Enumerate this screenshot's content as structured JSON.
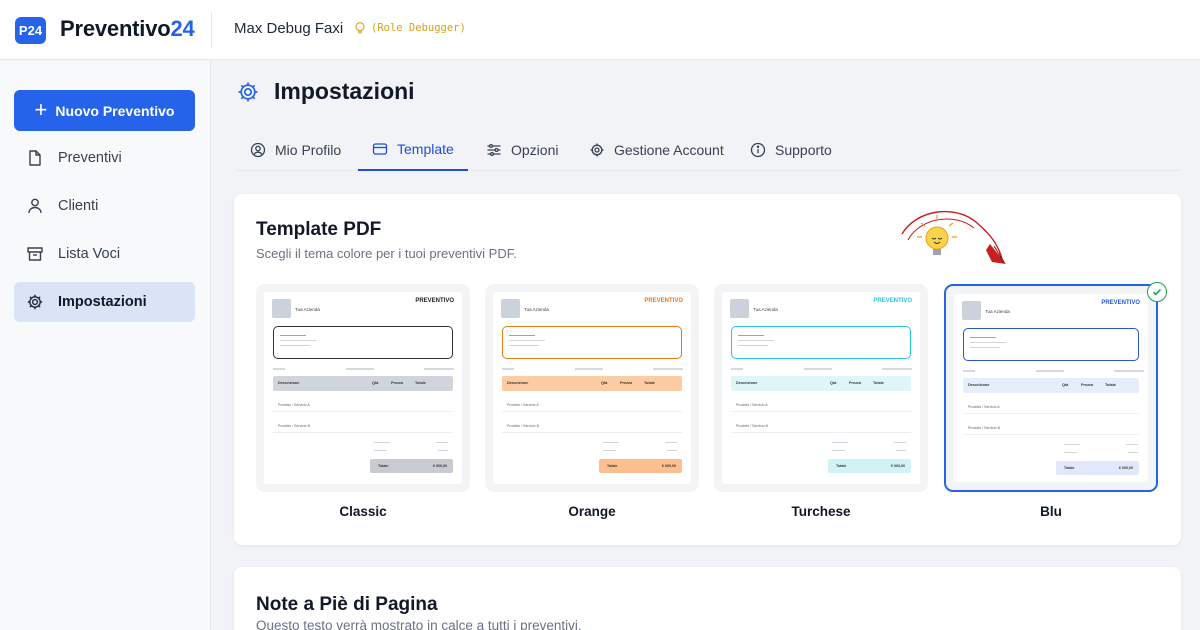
{
  "header": {
    "logo_badge": "P24",
    "app_name_main": "Preventivo",
    "app_name_accent": "24",
    "user_name": "Max Debug Faxi",
    "user_role": "(Role Debugger)"
  },
  "sidebar": {
    "new_button": "Nuovo Preventivo",
    "items": [
      {
        "label": "Preventivi",
        "icon": "document-icon"
      },
      {
        "label": "Clienti",
        "icon": "user-icon"
      },
      {
        "label": "Lista Voci",
        "icon": "archive-icon"
      },
      {
        "label": "Impostazioni",
        "icon": "gear-icon",
        "active": true
      }
    ]
  },
  "page": {
    "title": "Impostazioni",
    "tabs": [
      {
        "label": "Mio Profilo",
        "icon": "user-circle-icon"
      },
      {
        "label": "Template",
        "icon": "card-icon",
        "active": true
      },
      {
        "label": "Opzioni",
        "icon": "sliders-icon"
      },
      {
        "label": "Gestione Account",
        "icon": "gear-icon"
      },
      {
        "label": "Supporto",
        "icon": "info-icon"
      }
    ]
  },
  "template_card": {
    "title": "Template PDF",
    "subtitle": "Scegli il tema colore per i tuoi preventivi PDF.",
    "selected": "Blu",
    "templates": [
      {
        "name": "Classic",
        "accent": "#222222",
        "fill": "#d1d5db",
        "total_fill": "#c8cbd0"
      },
      {
        "name": "Orange",
        "accent": "#ea7a12",
        "fill": "#fdcba4",
        "total_fill": "#fdbf8f"
      },
      {
        "name": "Turchese",
        "accent": "#2ac7d6",
        "fill": "#dff6f8",
        "total_fill": "#d2f3f6"
      },
      {
        "name": "Blu",
        "accent": "#2a56d6",
        "fill": "#e8edfc",
        "total_fill": "#e2e8fb"
      }
    ],
    "preview": {
      "company": "Tua Azienda",
      "heading": "PREVENTIVO",
      "col_desc": "Descrizione",
      "col_qty": "Qtà",
      "col_price": "Prezzo",
      "col_total": "Totale",
      "row1": "Prodotto / Servizio A",
      "row2": "Prodotto / Servizio B",
      "total_label": "Totale",
      "total_value": "€ 000,00"
    }
  },
  "footer_card": {
    "title": "Note a Piè di Pagina",
    "subtitle": "Questo testo verrà mostrato in calce a tutti i preventivi."
  },
  "colors": {
    "primary": "#2563eb",
    "role": "#d4a017",
    "check": "#16a34a"
  }
}
